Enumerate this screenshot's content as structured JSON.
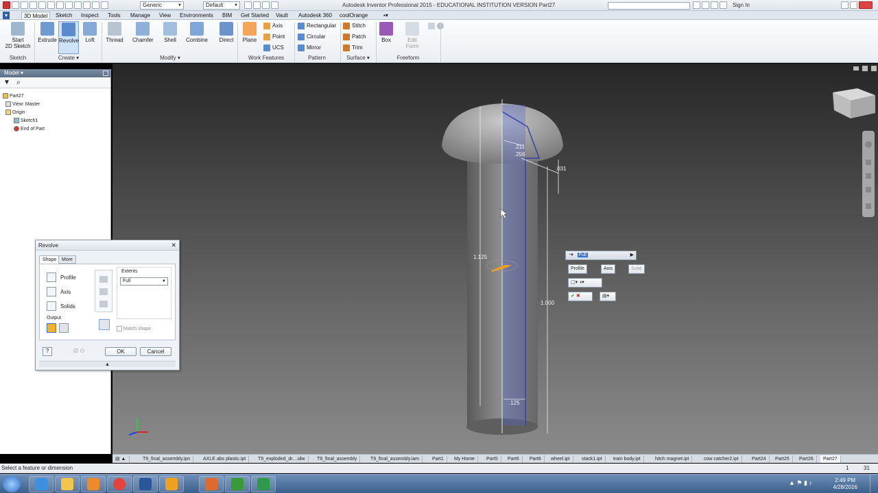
{
  "title_bar": {
    "app_title": "Autodesk Inventor Professional 2015 - EDUCATIONAL INSTITUTION VERSION    Part27",
    "material_combo": "Generic",
    "appearance_combo": "Default",
    "sign_in": "Sign In"
  },
  "ribbon_tabs": [
    "3D Model",
    "Sketch",
    "Inspect",
    "Tools",
    "Manage",
    "View",
    "Environments",
    "BIM",
    "Get Started",
    "Vault",
    "Autodesk 360",
    "coolOrange"
  ],
  "ribbon": {
    "sketch": {
      "start_label": "Start\n2D Sketch",
      "group": "Sketch"
    },
    "create": {
      "extrude": "Extrude",
      "revolve": "Revolve",
      "loft": "Loft",
      "group": "Create ▾"
    },
    "modify": {
      "thread": "Thread",
      "chamfer": "Chamfer",
      "shell": "Shell",
      "combine": "Combine",
      "direct": "Direct",
      "group": "Modify ▾"
    },
    "work": {
      "plane": "Plane",
      "axis": "Axis",
      "point": "Point",
      "ucs": "UCS",
      "group": "Work Features"
    },
    "pattern": {
      "rectangular": "Rectangular",
      "circular": "Circular",
      "mirror": "Mirror",
      "group": "Pattern"
    },
    "surface": {
      "stitch": "Stitch",
      "patch": "Patch",
      "trim": "Trim",
      "group": "Surface ▾"
    },
    "freeform": {
      "box": "Box",
      "edit_form": "Edit\nForm",
      "group": "Freeform"
    }
  },
  "browser": {
    "header": "Model ▾",
    "tree": [
      "Part27",
      "View: Master",
      "Origin",
      "Sketch1",
      "End of Part"
    ]
  },
  "viewport": {
    "dimensions": [
      "1.125",
      ".211",
      ".256",
      ".031",
      "1.000",
      ".125"
    ],
    "minitoolbar": {
      "extents_value": "Full",
      "profile": "Profile",
      "axis": "Axis",
      "solid": "Solid"
    }
  },
  "revolve_dialog": {
    "title": "Revolve",
    "tabs": [
      "Shape",
      "More"
    ],
    "profile": "Profile",
    "axis": "Axis",
    "solids": "Solids",
    "output": "Output",
    "extents_label": "Extents",
    "extents_value": "Full",
    "match_shape": "Match shape",
    "ok": "OK",
    "cancel": "Cancel"
  },
  "doc_tabs": [
    "T9_final_assembly.ipn",
    "AXLE abs plastic.ipt",
    "T9_exploded_dr....idw",
    "T9_final_assembly",
    "T9_final_assembly.iam",
    "Part1",
    "My Home",
    "Part5",
    "Part6",
    "Part8",
    "wheel.ipt",
    "stack1.ipt",
    "train body.ipt",
    "hitch magnet.ipt",
    "cow catcher2.ipt",
    "Part24",
    "Part25",
    "Part26",
    "Part27"
  ],
  "status": {
    "text": "Select a feature or dimension",
    "count1": "1",
    "count2": "31"
  },
  "taskbar": {
    "time": "2:49 PM",
    "date": "4/28/2016"
  },
  "colors": {
    "sketch_blue": "#3344aa",
    "viewport_top": "#262626",
    "viewport_bottom": "#8a8a8a",
    "accent": "#f0a020"
  }
}
